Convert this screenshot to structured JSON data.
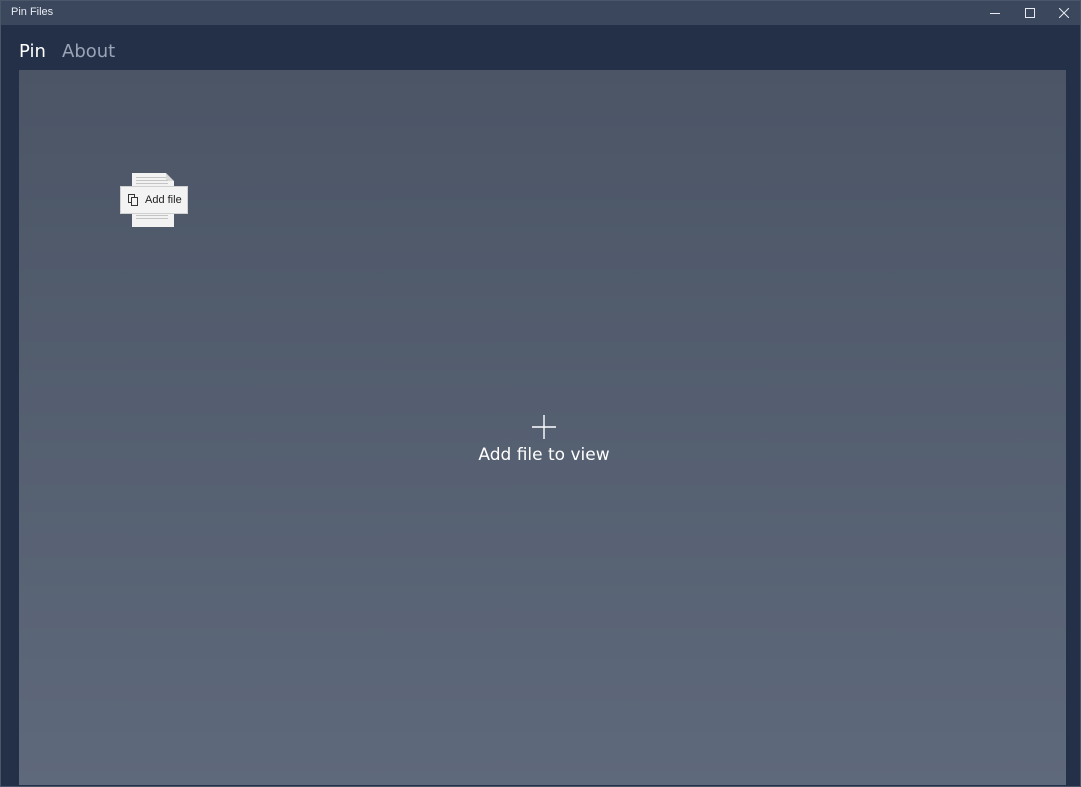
{
  "window": {
    "title": "Pin Files"
  },
  "nav": {
    "items": [
      {
        "label": "Pin",
        "selected": true
      },
      {
        "label": "About",
        "selected": false
      }
    ]
  },
  "drag_ghost": {
    "label": "Add file",
    "icon": "copy-icon"
  },
  "empty_state": {
    "icon": "plus-icon",
    "label": "Add file to view"
  },
  "colors": {
    "titlebar": "#3b475c",
    "nav_background": "#243048",
    "content_top": "#4b5566",
    "content_bottom": "#5e697b",
    "nav_selected": "#ffffff",
    "nav_unselected": "#9aa4b6"
  }
}
